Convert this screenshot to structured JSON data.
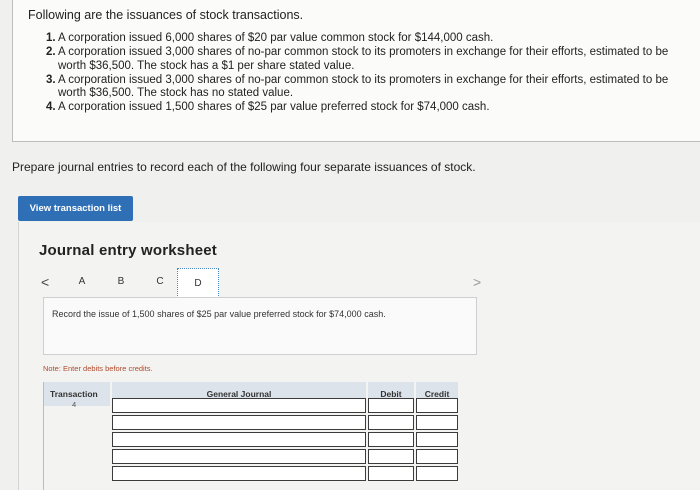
{
  "problem": {
    "intro": "Following are the issuances of stock transactions.",
    "items": [
      {
        "num": "1.",
        "text": "A corporation issued 6,000 shares of $20 par value common stock for $144,000 cash."
      },
      {
        "num": "2.",
        "text": "A corporation issued 3,000 shares of no-par common stock to its promoters in exchange for their efforts, estimated to be worth $36,500. The stock has a $1 per share stated value."
      },
      {
        "num": "3.",
        "text": "A corporation issued 3,000 shares of no-par common stock to its promoters in exchange for their efforts, estimated to be worth $36,500. The stock has no stated value."
      },
      {
        "num": "4.",
        "text": "A corporation issued 1,500 shares of $25 par value preferred stock for $74,000 cash."
      }
    ]
  },
  "prepare_text": "Prepare journal entries to record each of the following four separate issuances of stock.",
  "view_button": "View transaction list",
  "worksheet": {
    "title": "Journal entry worksheet",
    "nav_prev": "<",
    "nav_next": ">",
    "tabs": [
      "A",
      "B",
      "C",
      "D"
    ],
    "active_tab": "D",
    "instruction": "Record the issue of 1,500 shares of $25 par value preferred stock for $74,000 cash.",
    "note": "Note: Enter debits before credits.",
    "headers": {
      "transaction": "Transaction",
      "general_journal": "General Journal",
      "debit": "Debit",
      "credit": "Credit"
    },
    "rows": [
      {
        "transaction": "4"
      },
      {
        "transaction": ""
      },
      {
        "transaction": ""
      },
      {
        "transaction": ""
      },
      {
        "transaction": ""
      }
    ]
  }
}
